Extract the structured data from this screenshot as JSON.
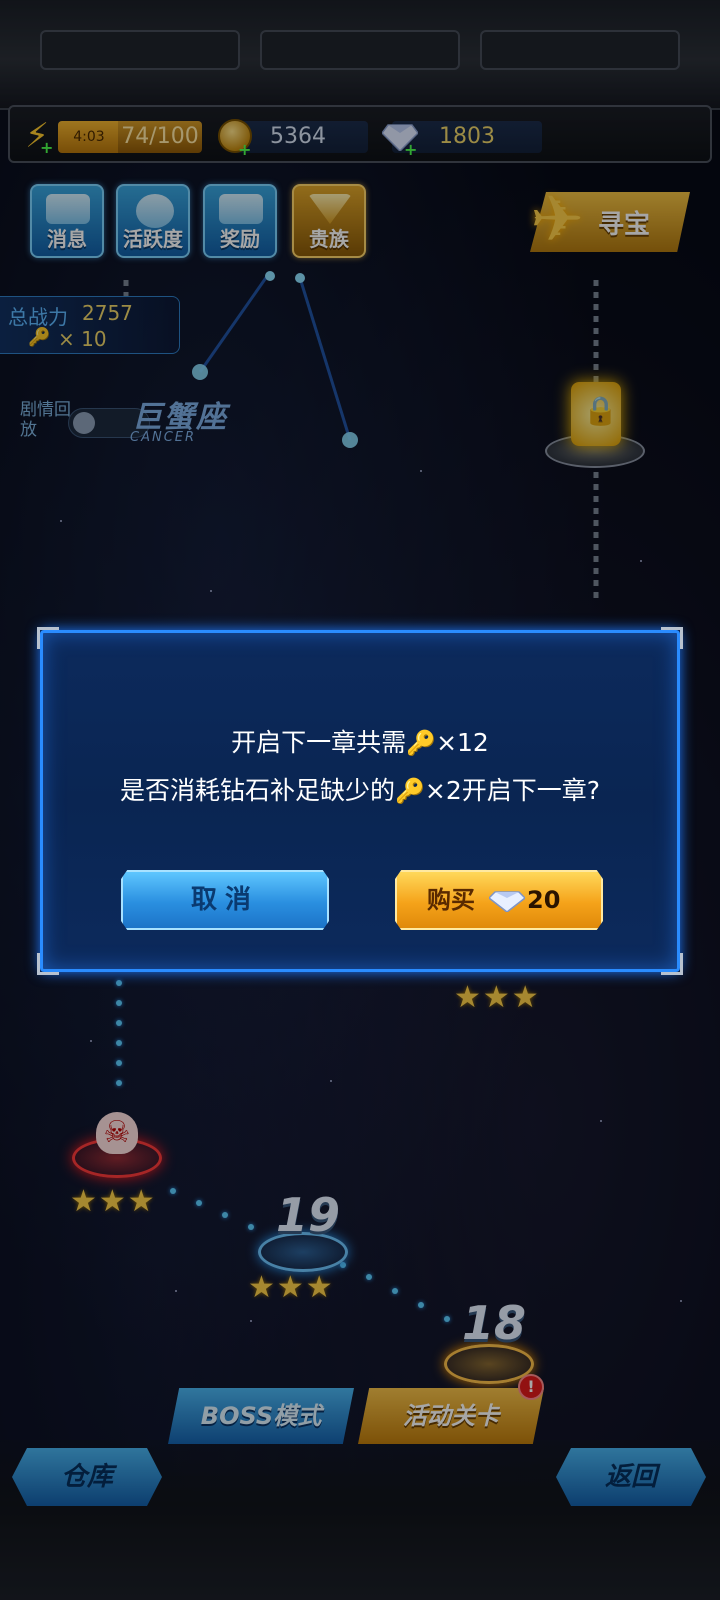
{
  "resources": {
    "energy_timer": "4:03",
    "energy": "74/100",
    "coins": "5364",
    "gems": "1803"
  },
  "top_buttons": [
    {
      "label": "消息",
      "icon": "envelope-icon"
    },
    {
      "label": "活跃度",
      "icon": "smiley-badge-icon"
    },
    {
      "label": "奖励",
      "icon": "gift-icon"
    },
    {
      "label": "贵族",
      "icon": "v-badge-icon"
    }
  ],
  "treasure": {
    "label": "寻宝",
    "icon": "jet-icon"
  },
  "player": {
    "power_label": "总战力",
    "power": "2757",
    "keys": "× 10"
  },
  "story_replay_label": "剧情回放",
  "constellation": {
    "name": "巨蟹座",
    "latin": "CANCER"
  },
  "stages": [
    {
      "number": "19",
      "stars": "★★★"
    },
    {
      "number": "18",
      "stars": "★★★"
    }
  ],
  "boss_stage_stars": "★★★",
  "upper_stage_stars": "★★★",
  "modes": {
    "boss": "BOSS模式",
    "event": "活动关卡",
    "event_badge": "!"
  },
  "nav": {
    "warehouse": "仓库",
    "back": "返回"
  },
  "dialog": {
    "line1_before": "开启下一章共需",
    "line1_after": "×12",
    "line2_before": "是否消耗钻石补足缺少的",
    "line2_after": "×2开启下一章?",
    "cancel": "取消",
    "buy": "购买",
    "price": "20"
  },
  "colors": {
    "dialog_bg": "#0a2552",
    "dialog_border": "#2a8cff",
    "cancel_button": "#2a8fe0",
    "buy_button": "#f5a31a",
    "star": "#ffd24a"
  }
}
